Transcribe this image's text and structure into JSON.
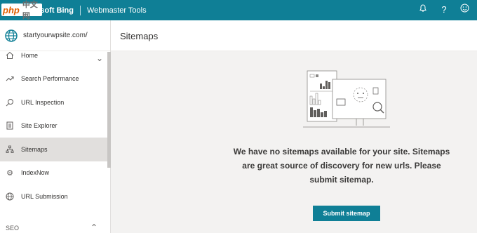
{
  "topbar": {
    "brand_label": "Microsoft Bing",
    "product_label": "Webmaster Tools",
    "icons": {
      "notifications": "bell-icon",
      "help": "question-icon",
      "feedback": "smiley-icon"
    }
  },
  "sidebar": {
    "site_url": "startyourwpsite.com/",
    "items": [
      {
        "label": "Home",
        "icon": "home-icon"
      },
      {
        "label": "Search Performance",
        "icon": "trend-icon"
      },
      {
        "label": "URL Inspection",
        "icon": "search-icon"
      },
      {
        "label": "Site Explorer",
        "icon": "document-icon"
      },
      {
        "label": "Sitemaps",
        "icon": "sitemap-icon",
        "selected": true
      },
      {
        "label": "IndexNow",
        "icon": "gear-icon"
      },
      {
        "label": "URL Submission",
        "icon": "globe-icon"
      }
    ],
    "section_label": "SEO"
  },
  "header": {
    "title": "Sitemaps"
  },
  "empty_state": {
    "message_line_1": "We have no sitemaps available for your site. Sitemaps",
    "message_line_2": "are great source of discovery for new urls. Please",
    "message_line_3": "submit sitemap.",
    "button_label": "Submit sitemap"
  },
  "colors": {
    "accent": "#0f7f96",
    "sidebar_selected": "#e1dfdd",
    "background": "#f3f2f1"
  }
}
